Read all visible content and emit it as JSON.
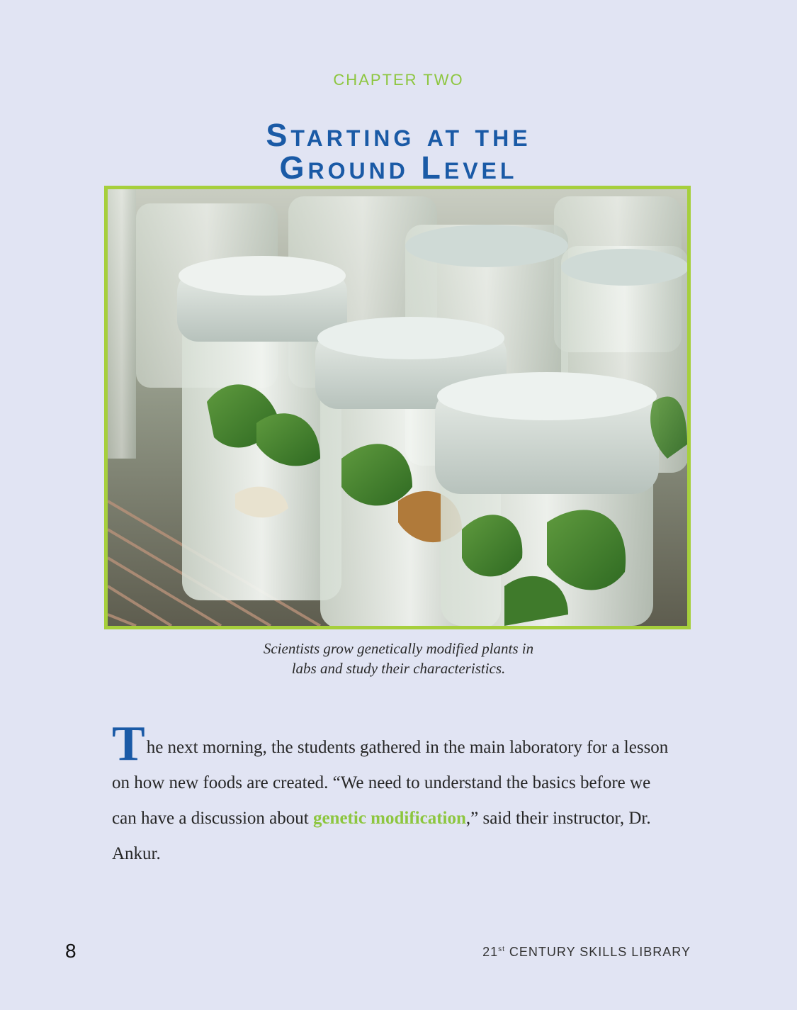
{
  "chapter": {
    "label": "CHAPTER TWO",
    "title_line1": "Starting at the",
    "title_line2": "Ground Level"
  },
  "figure": {
    "caption_line1": "Scientists grow genetically modified plants in",
    "caption_line2": "labs and study their characteristics.",
    "frame_color": "#a6cf3c"
  },
  "body": {
    "drop_cap": "T",
    "text_before_term": "he next morning, the students gathered in the main laboratory for a lesson on how new foods are created. “We need to understand the basics before we can have a discussion about ",
    "glossary_term": "genetic modification",
    "text_after_term": ",” said their instructor, Dr. Ankur."
  },
  "footer": {
    "page_number": "8",
    "series_prefix": "21",
    "series_superscript": "st",
    "series_suffix": " CENTURY SKILLS LIBRARY"
  },
  "colors": {
    "background": "#e1e4f3",
    "heading_blue": "#1a5aa6",
    "accent_green": "#8dc63f"
  }
}
